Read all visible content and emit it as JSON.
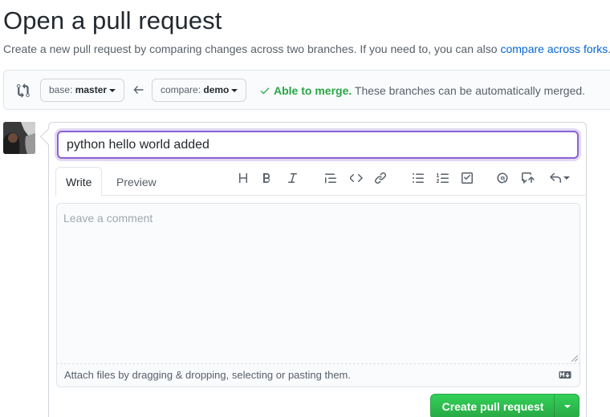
{
  "header": {
    "title": "Open a pull request",
    "subtitle": "Create a new pull request by comparing changes across two branches. If you need to, you can also ",
    "subtitle_link": "compare across forks",
    "subtitle_end": "."
  },
  "range": {
    "base_label": "base: ",
    "base_branch": "master",
    "compare_label": "compare: ",
    "compare_branch": "demo",
    "merge_status": "Able to merge.",
    "merge_detail": " These branches can be automatically merged.",
    "status_color": "#28a745"
  },
  "form": {
    "title_value": "python hello world added",
    "tabs": [
      {
        "label": "Write",
        "active": true
      },
      {
        "label": "Preview",
        "active": false
      }
    ],
    "toolbar": [
      "heading-icon",
      "bold-icon",
      "italic-icon",
      "quote-icon",
      "code-icon",
      "link-icon",
      "unordered-list-icon",
      "ordered-list-icon",
      "task-list-icon",
      "mention-icon",
      "reference-icon",
      "reply-icon"
    ],
    "comment_placeholder": "Leave a comment",
    "attach_text": "Attach files by dragging & dropping, selecting or pasting them.",
    "submit_label": "Create pull request",
    "accent_color": "#8a63d2"
  }
}
